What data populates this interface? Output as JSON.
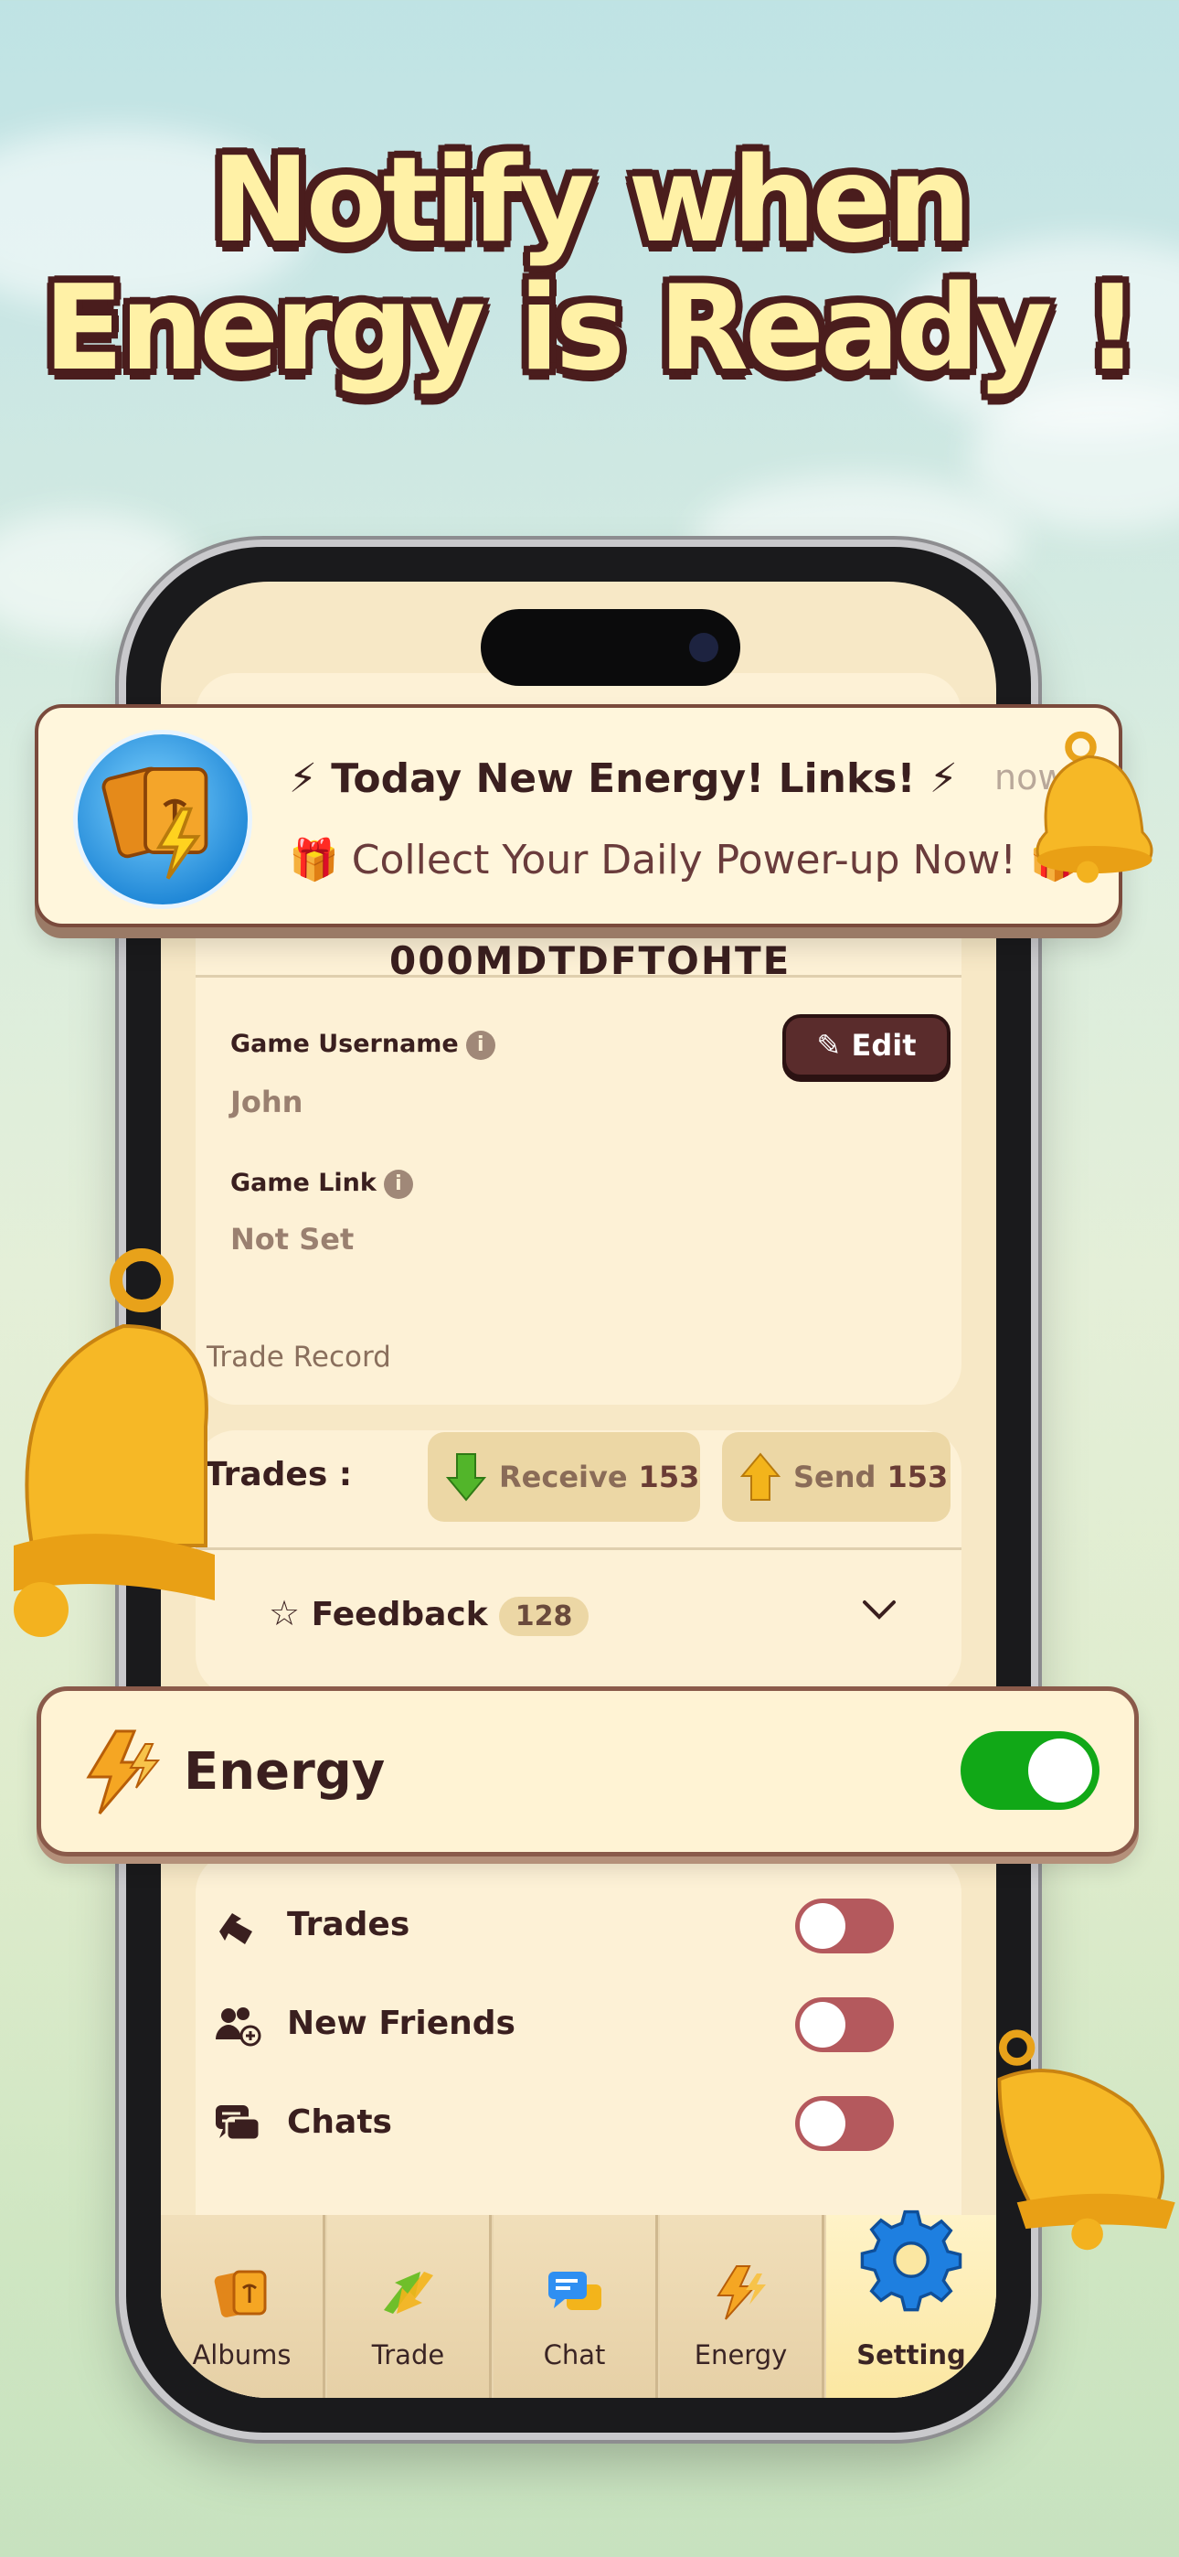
{
  "headline": {
    "line1": "Notify when",
    "line2": "Energy is Ready !"
  },
  "notification": {
    "title": "⚡ Today New Energy! Links! ⚡",
    "body": "🎁 Collect Your Daily Power-up Now! 🎁",
    "time": "now"
  },
  "profile": {
    "code_partial": "000MDTDFTOHTE",
    "username_label": "Game Username",
    "username_value": "John",
    "edit_label": "Edit",
    "link_label": "Game Link",
    "link_value": "Not Set",
    "info_glyph": "i"
  },
  "trade_record": {
    "section_label": "Trade Record",
    "trades_label": "Trades :",
    "receive_label": "Receive",
    "receive_count": "153",
    "send_label": "Send",
    "send_count": "153",
    "feedback_label": "Feedback",
    "feedback_count": "128"
  },
  "energy_setting": {
    "label": "Energy",
    "enabled": true
  },
  "notifications": {
    "items": [
      {
        "label": "Trades",
        "enabled": false,
        "icon": "trade-arrow-icon"
      },
      {
        "label": "New Friends",
        "enabled": false,
        "icon": "friends-icon"
      },
      {
        "label": "Chats",
        "enabled": false,
        "icon": "chat-bubbles-icon"
      }
    ]
  },
  "tabs": [
    {
      "label": "Albums",
      "icon": "albums-icon"
    },
    {
      "label": "Trade",
      "icon": "trade-icon"
    },
    {
      "label": "Chat",
      "icon": "chat-icon"
    },
    {
      "label": "Energy",
      "icon": "energy-icon"
    },
    {
      "label": "Setting",
      "icon": "gear-icon",
      "active": true
    }
  ],
  "colors": {
    "title_fill": "#fff1a6",
    "title_outline": "#4a1d1d",
    "toggle_on": "#11a817",
    "toggle_off": "#b4595d",
    "edit_button": "#5a2c2c"
  }
}
